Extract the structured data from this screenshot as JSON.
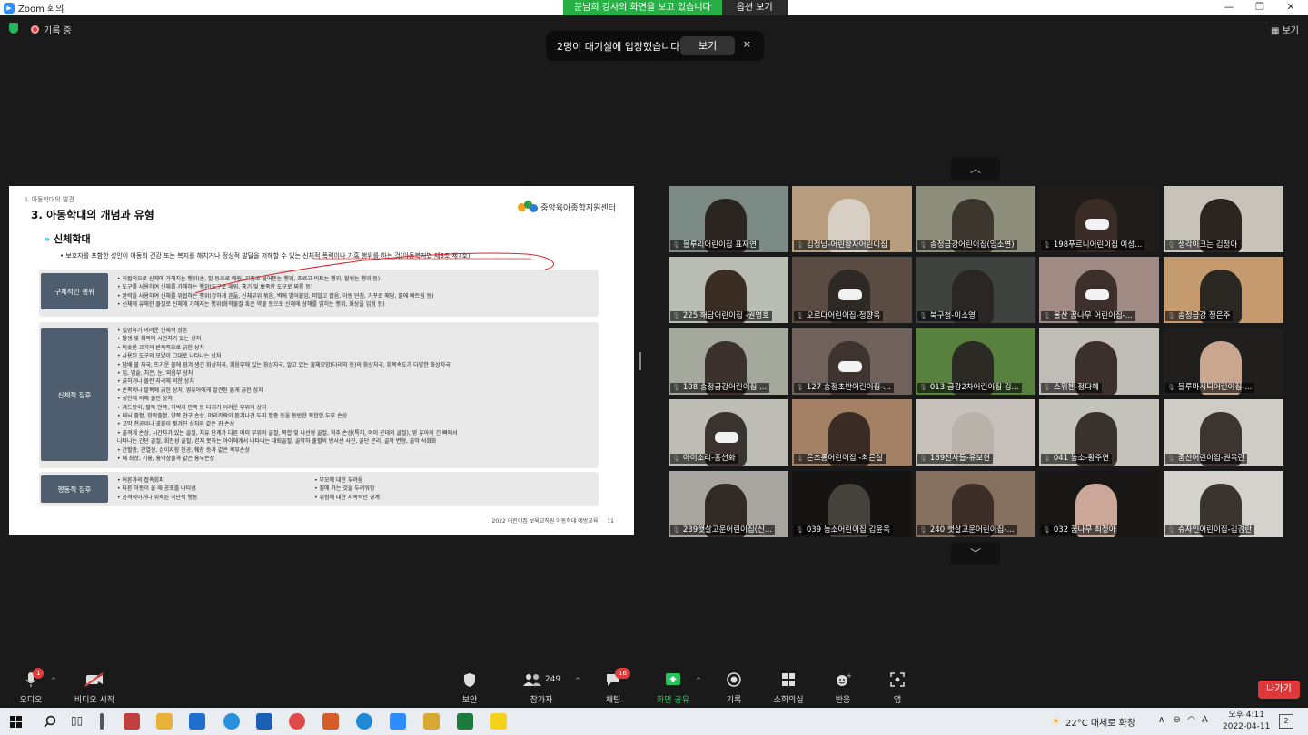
{
  "window": {
    "title": "Zoom 회의",
    "viewing_banner": "문남희 강사의 화면을 보고 있습니다",
    "view_options": "옵션 보기",
    "controls": [
      "—",
      "❐",
      "✕"
    ]
  },
  "meeting_bar": {
    "recording": "기록 중",
    "view": "보기"
  },
  "toast": {
    "message": "2명이 대기실에 입장했습니다",
    "button": "보기",
    "close": "×"
  },
  "slide": {
    "section": "Ⅰ. 아동학대의 발견",
    "title": "3. 아동학대의 개념과 유형",
    "org": "중앙육아종합지원센터",
    "subtitle": "신체학대",
    "definition": "• 보호자를 포함한 성인이 아동의 건강 또는 복지를 해치거나 정상적 발달을 저해할 수 있는 신체적 폭력이나 가혹 행위를 하는 것(아동복지법 제3조 제7호)",
    "panels": [
      {
        "label": "구체적인 행위",
        "items": [
          "• 직접적으로 신체에 가해지는 행위(손, 발 등으로 때림, 꼬집고 물어뜯는 행위, 조르고 비트는 행위, 할퀴는 행위 등)",
          "• 도구를 사용하여 신체를 가해하는 행위(도구로 때림, 흉기 및 뾰족한 도구로 찌름 등)",
          "• 완력을 사용하여 신체를 위협하는 행위(강하게 흔듦, 신체부위 묶음, 벽에 밀어붙임, 떠밀고 잡음, 아동 던짐, 거꾸로 매담, 물에 빠트림 등)",
          "• 신체에 유해한 물질로 신체에 가해지는 행위(화학물질 혹은 약물 등으로 신체에 상해를 입히는 행위, 화상을 입힘 등)"
        ]
      },
      {
        "label": "신체적 징후",
        "items": [
          "• 설명하기 어려운 신체적 상흔",
          "• 발생 및 회복에 시간차가 있는 상처",
          "• 비슷한 크기의 반복적으로 긁힌 상처",
          "• 사용된 도구의 모양이 그대로 나타나는 상처",
          "• 담배 불 자국, 뜨거운 물에 잠겨 생긴 화상자국, 회음부에 있는 화상자국, 알고 있는 물체모양(다리미 등)의 화상자국, 회복속도가 다양한 화상자국",
          "• 입, 입술, 치은, 눈, 외음부 상처",
          "• 긁히거나 물린 자국에 의한 상처",
          "• 손목이나 발목에 긁힌 상처, 영유아에게 발견된 붉게 긁힌 상처",
          "• 성인에 의해 물린 상처",
          "• 겨드랑이, 팔뚝 안쪽, 허벅지 안쪽 등 다치기 어려운 부위의 상처",
          "• 대뇌 출혈, 망막출혈, 양쪽 안구 손상, 머리카락이 뜯겨나간 두피 혈종 등을 동반한 복합한 두부 손상",
          "• 고막 천공이나 귓불이 찢겨진 상처와 같은 귀 손상",
          "• 골격계 손상, 시간차가 있는 골절, 치유 단계가 다른 여러 부위의 골절, 복합 및 나선형 골절, 척추 손상(특히, 여러 군데의 골절), 영 유아의 긴 뼈에서",
          "   나타나는 간단 골절, 회전성 골절, 걷지 못하는 아이에게서 나타나는 대퇴골절, 골막하 출혈의 방사선 사진, 골단 분리, 골막 변형, 골막 석회화",
          "• 간혈종, 간열상, 십이지장 천공, 췌장 등과 같은 복부손상",
          "• 폐 좌상, 기흉, 흉막삼출과 같은 흉부손상"
        ]
      },
      {
        "label": "행동적 징후",
        "items_left": [
          "• 어른과의 접촉회피",
          "• 다른 아동이 울 때 공포를 나타냄",
          "• 공격적이거나 위축된 극단적 행동"
        ],
        "items_right": [
          "• 부모에 대한 두려움",
          "• 집에 가는 것을 두려워함",
          "• 위험에 대한 지속적인 경계"
        ]
      }
    ],
    "footer": "2022 어린이집 보육교직원 아동학대 예방교육",
    "page": "11"
  },
  "gallery": {
    "up": "︿",
    "down": "﹀",
    "participants": [
      {
        "name": "블루리어린이집 표재연",
        "bg": "#7c8a86",
        "skin": "#2b2522",
        "mask": false
      },
      {
        "name": "김정남-어린왕자어린이집",
        "bg": "#b79d7e",
        "skin": "#d8cfc4",
        "mask": false
      },
      {
        "name": "송정금강어린이집(임소연)",
        "bg": "#8d8f7c",
        "skin": "#3c362f",
        "mask": false
      },
      {
        "name": "198푸르니어린이집 이성...",
        "bg": "#1f1c1a",
        "skin": "#3a2c27",
        "mask": true
      },
      {
        "name": "생각이크는 김정아",
        "bg": "#c7c3b9",
        "skin": "#2b2420",
        "mask": false
      },
      {
        "name": "225 해담어린이집 -권영호",
        "bg": "#b9bcb2",
        "skin": "#3a2d24",
        "mask": false
      },
      {
        "name": "오르다어린이집-정향옥",
        "bg": "#5a4b43",
        "skin": "#2f2925",
        "mask": true
      },
      {
        "name": "북구청-이소영",
        "bg": "#3e4340",
        "skin": "#2b2626",
        "mask": false
      },
      {
        "name": "울산 꿈나무 어린이집-...",
        "bg": "#9f8a84",
        "skin": "#3d2f2c",
        "mask": true
      },
      {
        "name": "송정금강 정은주",
        "bg": "#c49a6e",
        "skin": "#2a2622",
        "mask": false
      },
      {
        "name": "108 송정금강어린이집 ...",
        "bg": "#a5a89c",
        "skin": "#3b322d",
        "mask": false
      },
      {
        "name": "127 송정초반어린이집-...",
        "bg": "#6f625d",
        "skin": "#3d3430",
        "mask": true
      },
      {
        "name": "013 금강2차어린이집 김...",
        "bg": "#58803e",
        "skin": "#2c2a24",
        "mask": false
      },
      {
        "name": "스위첸-정다혜",
        "bg": "#c0bcb6",
        "skin": "#3b302b",
        "mask": false
      },
      {
        "name": "블루마시티어린이집-...",
        "bg": "#211f1e",
        "skin": "#c8a690",
        "mask": false
      },
      {
        "name": "아이소리-홍선화",
        "bg": "#bdbdb5",
        "skin": "#3a332f",
        "mask": true
      },
      {
        "name": "은초롱어린이집 -최은실",
        "bg": "#a48164",
        "skin": "#3a2c25",
        "mask": false
      },
      {
        "name": "189천사들-유보현",
        "bg": "#c6c2bb",
        "skin": "#b9b2aa",
        "mask": false
      },
      {
        "name": "041 농소-황주연",
        "bg": "#c3c2bb",
        "skin": "#3a322d",
        "mask": false
      },
      {
        "name": "중산어린이집-권옥란",
        "bg": "#cfccc6",
        "skin": "#3c3430",
        "mask": false
      },
      {
        "name": "239햇살고운어린이집(신...",
        "bg": "#a8a4a0",
        "skin": "#312924",
        "mask": false
      },
      {
        "name": "039 농소어린이집 김윤옥",
        "bg": "#151413",
        "skin": "#46423c",
        "mask": false
      },
      {
        "name": "240 햇살고운어린이집-...",
        "bg": "#857060",
        "skin": "#3d2f28",
        "mask": false
      },
      {
        "name": "032 꿈나무 최정아",
        "bg": "#181716",
        "skin": "#caa798",
        "mask": false
      },
      {
        "name": "슈자인어린이집-김경란",
        "bg": "#d4d2cd",
        "skin": "#3b332f",
        "mask": false
      }
    ]
  },
  "toolbar": {
    "audio": "오디오",
    "video": "비디오 시작",
    "security": "보안",
    "participants": "참가자",
    "participant_count": "249",
    "chat": "채팅",
    "chat_badge": "16",
    "share": "화면 공유",
    "record": "기록",
    "breakout": "소회의실",
    "reactions": "반응",
    "apps": "앱",
    "leave": "나가기",
    "audio_badge": "1"
  },
  "taskbar": {
    "weather": "22°C 대체로 화창",
    "ime": "A",
    "time": "오후 4:11",
    "date": "2022-04-11",
    "notifications": "2"
  }
}
